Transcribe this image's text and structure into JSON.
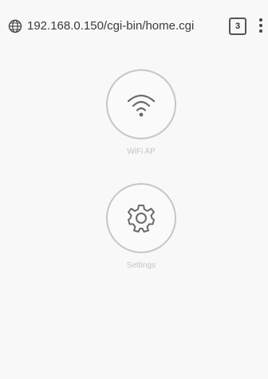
{
  "browser": {
    "url": "192.168.0.150/cgi-bin/home.cgi",
    "tab_count": "3",
    "site_icon": "globe-icon",
    "menu_icon": "more-vert-icon"
  },
  "apps": [
    {
      "label": "WiFi AP",
      "icon": "wifi-icon"
    },
    {
      "label": "Settings",
      "icon": "gear-icon"
    }
  ],
  "colors": {
    "background": "#f8f8f8",
    "circle_border": "#c6c6c6",
    "icon_stroke": "#6a6a6a",
    "label": "#c4c4c4"
  }
}
